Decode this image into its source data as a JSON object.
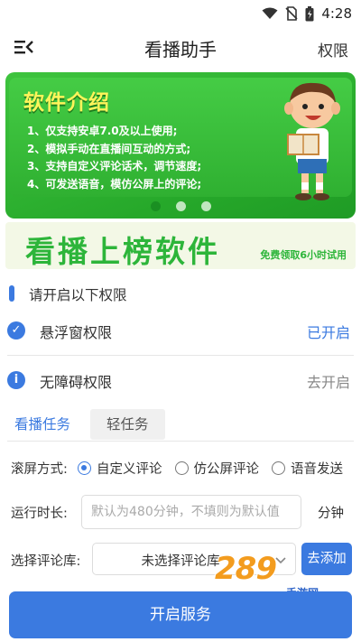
{
  "status_bar": {
    "time": "4:28"
  },
  "app_bar": {
    "title": "看播助手",
    "permission_link": "权限"
  },
  "banner": {
    "title": "软件介绍",
    "lines": [
      "1、仅支持安卓7.0及以上使用;",
      "2、模拟手动在直播间互动的方式;",
      "3、支持自定义评论话术，调节速度;",
      "4、可发送语音，模仿公屏上的评论;"
    ],
    "active_slide": 1,
    "slide_count": 3
  },
  "ad": {
    "headline": "看播上榜软件",
    "subline": "免费领取6小时试用"
  },
  "permissions": {
    "header": "请开启以下权限",
    "items": [
      {
        "icon": "check-circle-icon",
        "label": "悬浮窗权限",
        "action": "已开启",
        "action_color": "#3b7ae0"
      },
      {
        "icon": "info-circle-icon",
        "label": "无障碍权限",
        "action": "去开启",
        "action_color": "#888888"
      }
    ]
  },
  "tasks": {
    "tabs": [
      {
        "label": "看播任务",
        "active": true
      },
      {
        "label": "轻任务",
        "active": false
      }
    ],
    "scroll_mode": {
      "label": "滚屏方式:",
      "options": [
        {
          "label": "自定义评论",
          "checked": true
        },
        {
          "label": "仿公屏评论",
          "checked": false
        },
        {
          "label": "语音发送",
          "checked": false
        }
      ]
    },
    "run_duration": {
      "label": "运行时长:",
      "placeholder": "默认为480分钟，不填则为默认值",
      "value": "",
      "unit": "分钟"
    },
    "comment_library": {
      "label": "选择评论库:",
      "selected": "未选择评论库",
      "add_button": "去添加"
    },
    "start_button": "开启服务"
  },
  "watermark": {
    "number": "289",
    "text": "手游网"
  },
  "colors": {
    "accent": "#3b7ae0",
    "banner_green": "#2fb031",
    "ad_green": "#2db53a"
  }
}
